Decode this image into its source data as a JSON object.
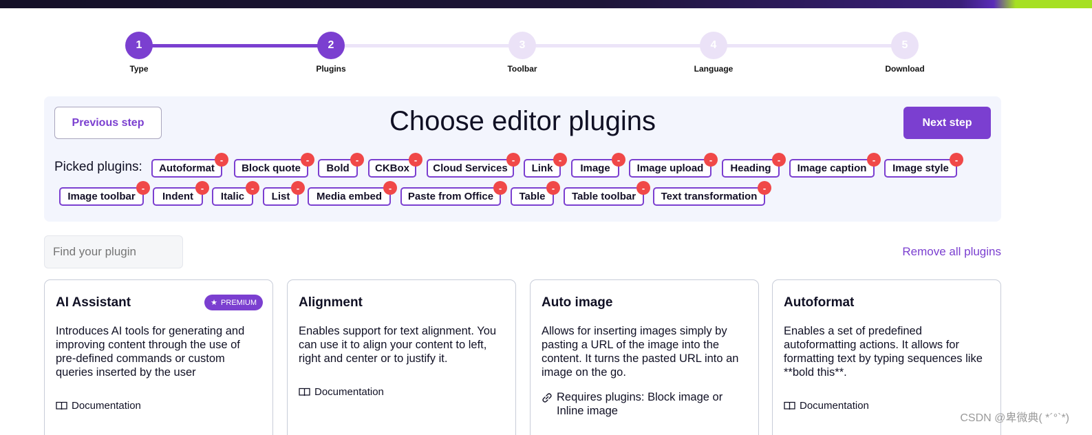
{
  "stepper": {
    "steps": [
      {
        "number": "1",
        "label": "Type",
        "state": "done"
      },
      {
        "number": "2",
        "label": "Plugins",
        "state": "current"
      },
      {
        "number": "3",
        "label": "Toolbar",
        "state": "pending"
      },
      {
        "number": "4",
        "label": "Language",
        "state": "pending"
      },
      {
        "number": "5",
        "label": "Download",
        "state": "pending"
      }
    ]
  },
  "panel": {
    "title": "Choose editor plugins",
    "prev_label": "Previous step",
    "next_label": "Next step",
    "picked_label": "Picked plugins:",
    "remove_symbol": "-",
    "chips": [
      "Autoformat",
      "Block quote",
      "Bold",
      "CKBox",
      "Cloud Services",
      "Link",
      "Image",
      "Image upload",
      "Heading",
      "Image caption",
      "Image style",
      "Image toolbar",
      "Indent",
      "Italic",
      "List",
      "Media embed",
      "Paste from Office",
      "Table",
      "Table toolbar",
      "Text transformation"
    ]
  },
  "search": {
    "placeholder": "Find your plugin"
  },
  "remove_all_label": "Remove all plugins",
  "cards": [
    {
      "title": "AI Assistant",
      "badge": "PREMIUM",
      "description": "Introduces AI tools for generating and improving content through the use of pre-defined commands or custom queries inserted by the user",
      "meta_icon": "book-icon",
      "meta": "Documentation"
    },
    {
      "title": "Alignment",
      "description": "Enables support for text alignment. You can use it to align your content to left, right and center or to justify it.",
      "meta_icon": "book-icon",
      "meta": "Documentation"
    },
    {
      "title": "Auto image",
      "description": "Allows for inserting images simply by pasting a URL of the image into the content. It turns the pasted URL into an image on the go.",
      "meta_icon": "link-icon",
      "meta": "Requires plugins: Block image or Inline image"
    },
    {
      "title": "Autoformat",
      "description": "Enables a set of predefined autoformatting actions. It allows for formatting text by typing sequences like **bold this**.",
      "meta_icon": "book-icon",
      "meta": "Documentation"
    }
  ],
  "watermark": "CSDN @卑微典( *´°`*)",
  "colors": {
    "accent": "#7b3fd0",
    "remove": "#f04848",
    "panel_bg": "#f3f5fd"
  }
}
